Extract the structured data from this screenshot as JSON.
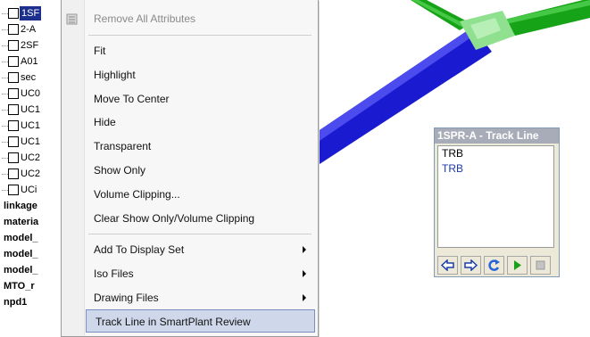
{
  "tree": {
    "items": [
      {
        "label": "1SF",
        "selected": true
      },
      {
        "label": "2-A"
      },
      {
        "label": "2SF"
      },
      {
        "label": "A01"
      },
      {
        "label": "sec"
      },
      {
        "label": "UC0"
      },
      {
        "label": "UC1"
      },
      {
        "label": "UC1"
      },
      {
        "label": "UC1"
      },
      {
        "label": "UC2"
      },
      {
        "label": "UC2"
      },
      {
        "label": "UCi"
      }
    ],
    "bold_items": [
      "linkage",
      "materia",
      "model_",
      "model_",
      "model_",
      "MTO_r",
      "npd1"
    ]
  },
  "context_menu": {
    "items": [
      {
        "label": "Remove All Attributes",
        "disabled": true,
        "icon": "attributes-icon"
      },
      {
        "label": "Fit"
      },
      {
        "label": "Highlight"
      },
      {
        "label": "Move To Center"
      },
      {
        "label": "Hide"
      },
      {
        "label": "Transparent"
      },
      {
        "label": "Show Only"
      },
      {
        "label": "Volume Clipping..."
      },
      {
        "label": "Clear Show Only/Volume Clipping"
      },
      {
        "label": "Add To Display Set",
        "submenu": true
      },
      {
        "label": "Iso Files",
        "submenu": true
      },
      {
        "label": "Drawing Files",
        "submenu": true
      },
      {
        "label": "Track Line in SmartPlant Review",
        "hover": true
      }
    ]
  },
  "track_dialog": {
    "title": "1SPR-A - Track Line",
    "list_items": [
      "TRB",
      "TRB"
    ],
    "buttons": [
      "back-arrow-icon",
      "forward-arrow-icon",
      "refresh-icon",
      "play-icon",
      "stop-icon"
    ]
  },
  "colors": {
    "pipe_blue": "#1a1ad0",
    "pipe_green": "#17a317",
    "fitting_green": "#8fe08f",
    "menu_hover": "#cfd8ea",
    "tree_selected": "#1c2f8c"
  }
}
